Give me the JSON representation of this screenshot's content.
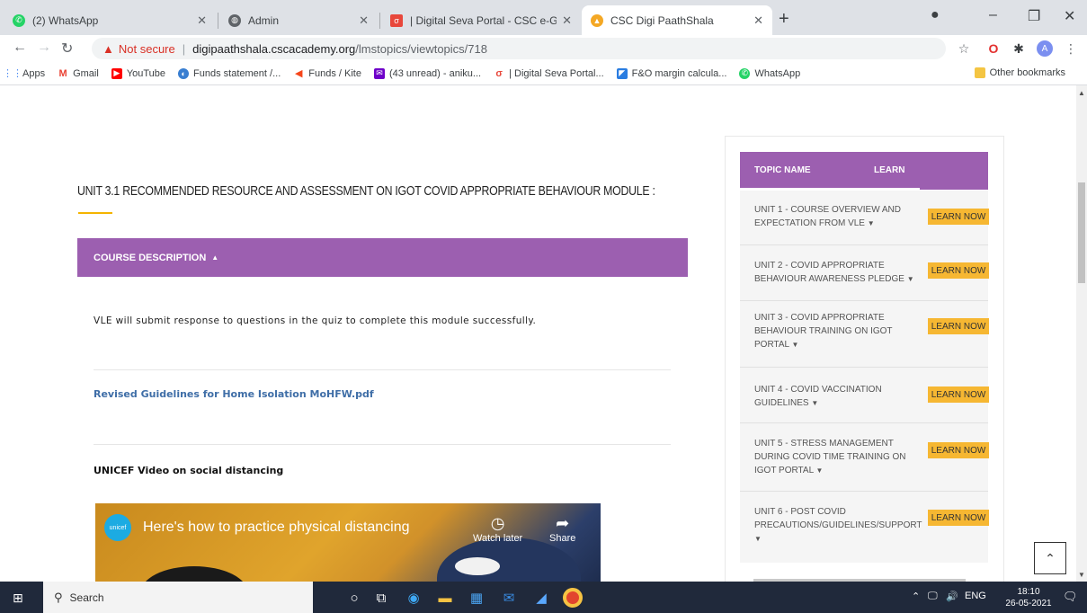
{
  "browser": {
    "tabs": [
      {
        "title": "(2) WhatsApp"
      },
      {
        "title": "Admin"
      },
      {
        "title": "| Digital Seva Portal - CSC e-Gove"
      },
      {
        "title": "CSC Digi PaathShala"
      }
    ],
    "new_tab_symbol": "+",
    "address": {
      "security_label": "Not secure",
      "host": "digipaathshala.cscacademy.org",
      "path": "/lmstopics/viewtopics/718"
    },
    "bookmarks": [
      {
        "label": "Apps"
      },
      {
        "label": "Gmail"
      },
      {
        "label": "YouTube"
      },
      {
        "label": "Funds statement /..."
      },
      {
        "label": "Funds / Kite"
      },
      {
        "label": "(43 unread) - aniku..."
      },
      {
        "label": "| Digital Seva Portal..."
      },
      {
        "label": "F&O margin calcula..."
      },
      {
        "label": "WhatsApp"
      }
    ],
    "other_bookmarks": "Other bookmarks",
    "profile_initial": "A"
  },
  "main": {
    "heading": "UNIT 3.1 RECOMMENDED RESOURCE AND ASSESSMENT ON IGOT COVID APPROPRIATE BEHAVIOUR MODULE :",
    "course_description_label": "COURSE DESCRIPTION",
    "description": "VLE will submit response to questions in the quiz to complete this module successfully.",
    "pdf_link": "Revised Guidelines for Home Isolation MoHFW.pdf",
    "video_section_title": "UNICEF Video on social distancing",
    "video": {
      "logo_text": "unicef",
      "title": "Here's how to practice physical distancing",
      "watch_later": "Watch later",
      "share": "Share"
    }
  },
  "sidebar": {
    "col_topic": "TOPIC NAME",
    "col_learn": "LEARN",
    "learn_label": "LEARN NOW",
    "units": [
      {
        "name": "UNIT 1 - COURSE OVERVIEW AND EXPECTATION FROM VLE"
      },
      {
        "name": "UNIT 2 - COVID APPROPRIATE BEHAVIOUR AWARENESS PLEDGE"
      },
      {
        "name": "UNIT 3 - COVID APPROPRIATE BEHAVIOUR TRAINING ON IGOT PORTAL"
      },
      {
        "name": "UNIT 4 - COVID VACCINATION GUIDELINES"
      },
      {
        "name": "UNIT 5 - STRESS MANAGEMENT DURING COVID TIME TRAINING ON IGOT PORTAL"
      },
      {
        "name": "UNIT 6 - POST COVID PRECAUTIONS/GUIDELINES/SUPPORT"
      }
    ]
  },
  "taskbar": {
    "search_placeholder": "Search",
    "language": "ENG",
    "time": "18:10",
    "date": "26-05-2021"
  },
  "colors": {
    "purple": "#9c5fb0",
    "learn_button": "#f6b732",
    "accent_underline": "#f4b400",
    "link": "#3f6ea7"
  }
}
